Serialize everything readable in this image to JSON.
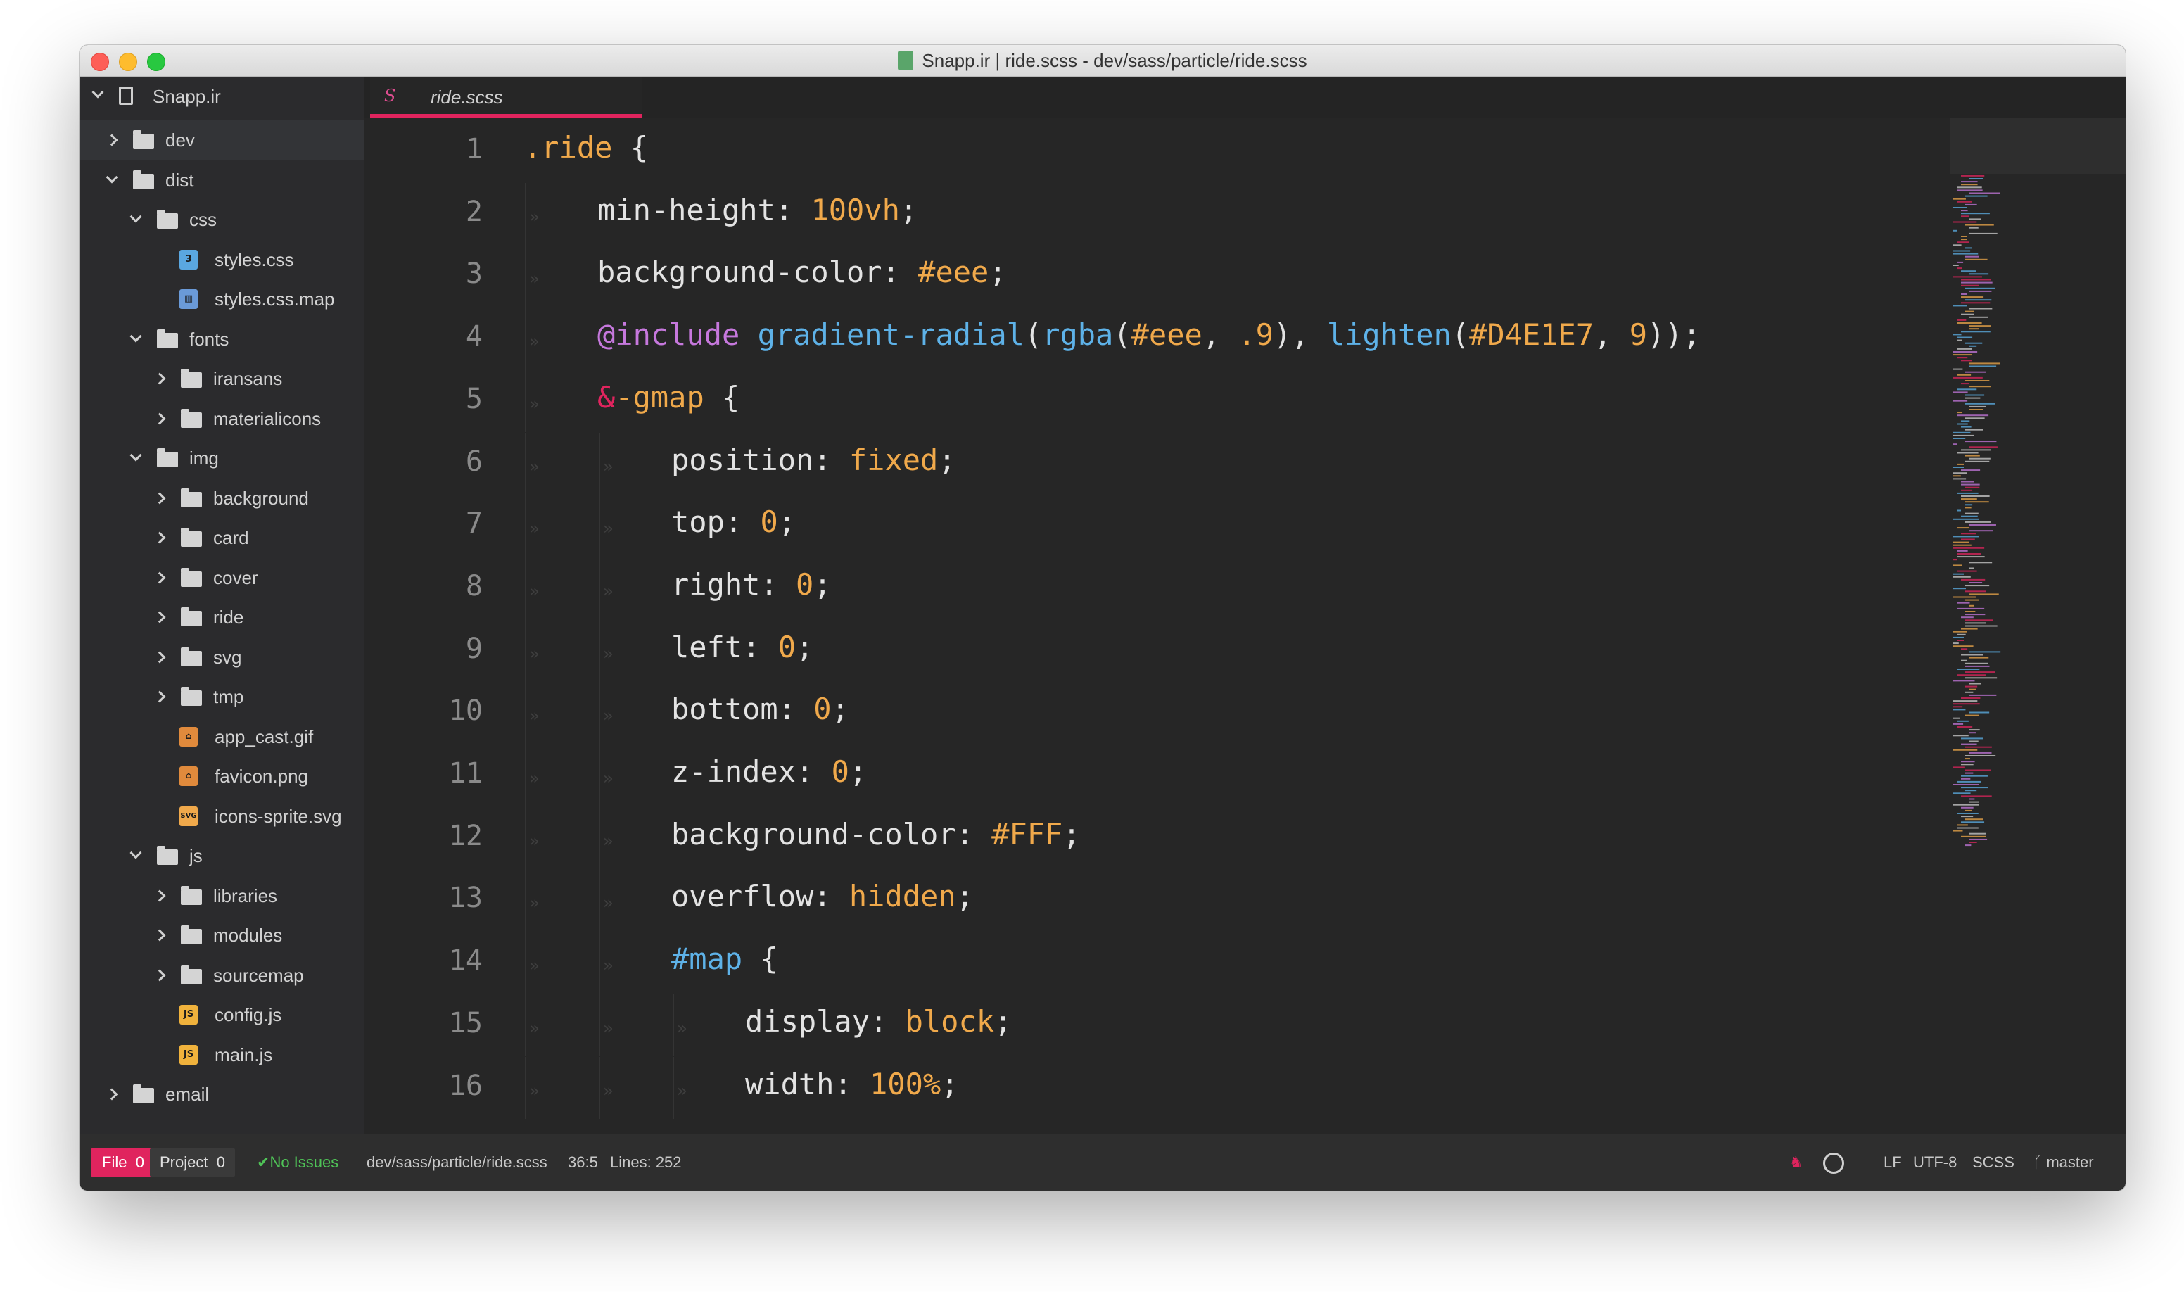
{
  "window": {
    "title": "Snapp.ir | ride.scss - dev/sass/particle/ride.scss"
  },
  "sidebar": {
    "project_name": "Snapp.ir",
    "tree": [
      {
        "label": "dev",
        "type": "folder",
        "depth": 0,
        "expanded": false,
        "selected": true
      },
      {
        "label": "dist",
        "type": "folder",
        "depth": 0,
        "expanded": true
      },
      {
        "label": "css",
        "type": "folder",
        "depth": 1,
        "expanded": true
      },
      {
        "label": "styles.css",
        "type": "file",
        "depth": 2,
        "icon": "css3-icon"
      },
      {
        "label": "styles.css.map",
        "type": "file",
        "depth": 2,
        "icon": "map-icon"
      },
      {
        "label": "fonts",
        "type": "folder",
        "depth": 1,
        "expanded": true
      },
      {
        "label": "iransans",
        "type": "folder",
        "depth": 2,
        "expanded": false
      },
      {
        "label": "materialicons",
        "type": "folder",
        "depth": 2,
        "expanded": false
      },
      {
        "label": "img",
        "type": "folder",
        "depth": 1,
        "expanded": true
      },
      {
        "label": "background",
        "type": "folder",
        "depth": 2,
        "expanded": false
      },
      {
        "label": "card",
        "type": "folder",
        "depth": 2,
        "expanded": false
      },
      {
        "label": "cover",
        "type": "folder",
        "depth": 2,
        "expanded": false
      },
      {
        "label": "ride",
        "type": "folder",
        "depth": 2,
        "expanded": false
      },
      {
        "label": "svg",
        "type": "folder",
        "depth": 2,
        "expanded": false
      },
      {
        "label": "tmp",
        "type": "folder",
        "depth": 2,
        "expanded": false
      },
      {
        "label": "app_cast.gif",
        "type": "file",
        "depth": 2,
        "icon": "image-file-icon"
      },
      {
        "label": "favicon.png",
        "type": "file",
        "depth": 2,
        "icon": "image-file-icon"
      },
      {
        "label": "icons-sprite.svg",
        "type": "file",
        "depth": 2,
        "icon": "svg-file-icon"
      },
      {
        "label": "js",
        "type": "folder",
        "depth": 1,
        "expanded": true
      },
      {
        "label": "libraries",
        "type": "folder",
        "depth": 2,
        "expanded": false
      },
      {
        "label": "modules",
        "type": "folder",
        "depth": 2,
        "expanded": false
      },
      {
        "label": "sourcemap",
        "type": "folder",
        "depth": 2,
        "expanded": false
      },
      {
        "label": "config.js",
        "type": "file",
        "depth": 2,
        "icon": "js-file-icon"
      },
      {
        "label": "main.js",
        "type": "file",
        "depth": 2,
        "icon": "js-file-icon"
      },
      {
        "label": "email",
        "type": "folder",
        "depth": 0,
        "expanded": false
      }
    ]
  },
  "tab": {
    "label": "ride.scss",
    "icon": "sass-icon"
  },
  "editor": {
    "lines": [
      {
        "num": "1",
        "indent": 0,
        "tokens": [
          {
            "t": ".ride",
            "c": "sel"
          },
          {
            "t": " {",
            "c": "punc"
          }
        ]
      },
      {
        "num": "2",
        "indent": 1,
        "tokens": [
          {
            "t": "min-height",
            "c": "prop"
          },
          {
            "t": ": ",
            "c": "punc"
          },
          {
            "t": "100vh",
            "c": "num"
          },
          {
            "t": ";",
            "c": "punc"
          }
        ]
      },
      {
        "num": "3",
        "indent": 1,
        "tokens": [
          {
            "t": "background-color",
            "c": "prop"
          },
          {
            "t": ": ",
            "c": "punc"
          },
          {
            "t": "#eee",
            "c": "val"
          },
          {
            "t": ";",
            "c": "punc"
          }
        ]
      },
      {
        "num": "4",
        "indent": 1,
        "tokens": [
          {
            "t": "@include",
            "c": "at"
          },
          {
            "t": " ",
            "c": "punc"
          },
          {
            "t": "gradient-radial",
            "c": "fn"
          },
          {
            "t": "(",
            "c": "punc"
          },
          {
            "t": "rgba",
            "c": "fn"
          },
          {
            "t": "(",
            "c": "punc"
          },
          {
            "t": "#eee",
            "c": "val"
          },
          {
            "t": ", ",
            "c": "punc"
          },
          {
            "t": ".9",
            "c": "num"
          },
          {
            "t": "), ",
            "c": "punc"
          },
          {
            "t": "lighten",
            "c": "fn"
          },
          {
            "t": "(",
            "c": "punc"
          },
          {
            "t": "#D4E1E7",
            "c": "val"
          },
          {
            "t": ", ",
            "c": "punc"
          },
          {
            "t": "9",
            "c": "num"
          },
          {
            "t": "));",
            "c": "punc"
          }
        ]
      },
      {
        "num": "5",
        "indent": 1,
        "tokens": [
          {
            "t": "&",
            "c": "amp"
          },
          {
            "t": "-gmap",
            "c": "sel"
          },
          {
            "t": " {",
            "c": "punc"
          }
        ]
      },
      {
        "num": "6",
        "indent": 2,
        "tokens": [
          {
            "t": "position",
            "c": "prop"
          },
          {
            "t": ": ",
            "c": "punc"
          },
          {
            "t": "fixed",
            "c": "val"
          },
          {
            "t": ";",
            "c": "punc"
          }
        ]
      },
      {
        "num": "7",
        "indent": 2,
        "tokens": [
          {
            "t": "top",
            "c": "prop"
          },
          {
            "t": ": ",
            "c": "punc"
          },
          {
            "t": "0",
            "c": "num"
          },
          {
            "t": ";",
            "c": "punc"
          }
        ]
      },
      {
        "num": "8",
        "indent": 2,
        "tokens": [
          {
            "t": "right",
            "c": "prop"
          },
          {
            "t": ": ",
            "c": "punc"
          },
          {
            "t": "0",
            "c": "num"
          },
          {
            "t": ";",
            "c": "punc"
          }
        ]
      },
      {
        "num": "9",
        "indent": 2,
        "tokens": [
          {
            "t": "left",
            "c": "prop"
          },
          {
            "t": ": ",
            "c": "punc"
          },
          {
            "t": "0",
            "c": "num"
          },
          {
            "t": ";",
            "c": "punc"
          }
        ]
      },
      {
        "num": "10",
        "indent": 2,
        "tokens": [
          {
            "t": "bottom",
            "c": "prop"
          },
          {
            "t": ": ",
            "c": "punc"
          },
          {
            "t": "0",
            "c": "num"
          },
          {
            "t": ";",
            "c": "punc"
          }
        ]
      },
      {
        "num": "11",
        "indent": 2,
        "tokens": [
          {
            "t": "z-index",
            "c": "prop"
          },
          {
            "t": ": ",
            "c": "punc"
          },
          {
            "t": "0",
            "c": "num"
          },
          {
            "t": ";",
            "c": "punc"
          }
        ]
      },
      {
        "num": "12",
        "indent": 2,
        "tokens": [
          {
            "t": "background-color",
            "c": "prop"
          },
          {
            "t": ": ",
            "c": "punc"
          },
          {
            "t": "#FFF",
            "c": "val"
          },
          {
            "t": ";",
            "c": "punc"
          }
        ]
      },
      {
        "num": "13",
        "indent": 2,
        "tokens": [
          {
            "t": "overflow",
            "c": "prop"
          },
          {
            "t": ": ",
            "c": "punc"
          },
          {
            "t": "hidden",
            "c": "val"
          },
          {
            "t": ";",
            "c": "punc"
          }
        ]
      },
      {
        "num": "14",
        "indent": 2,
        "tokens": [
          {
            "t": "#map",
            "c": "id"
          },
          {
            "t": " {",
            "c": "punc"
          }
        ]
      },
      {
        "num": "15",
        "indent": 3,
        "tokens": [
          {
            "t": "display",
            "c": "prop"
          },
          {
            "t": ": ",
            "c": "punc"
          },
          {
            "t": "block",
            "c": "val"
          },
          {
            "t": ";",
            "c": "punc"
          }
        ]
      },
      {
        "num": "16",
        "indent": 3,
        "tokens": [
          {
            "t": "width",
            "c": "prop"
          },
          {
            "t": ": ",
            "c": "punc"
          },
          {
            "t": "100%",
            "c": "num"
          },
          {
            "t": ";",
            "c": "punc"
          }
        ]
      }
    ]
  },
  "statusbar": {
    "file_label": "File",
    "file_count": "0",
    "project_label": "Project",
    "project_count": "0",
    "issues_text": "No Issues",
    "path": "dev/sass/particle/ride.scss",
    "cursor": "36:5",
    "lines": "Lines: 252",
    "line_ending": "LF",
    "encoding": "UTF-8",
    "grammar": "SCSS",
    "branch": "master"
  },
  "colors": {
    "accent": "#e0245e",
    "selector": "#f0a94b",
    "function": "#5eb2e8",
    "at_rule": "#c678dd",
    "background": "#262626"
  }
}
